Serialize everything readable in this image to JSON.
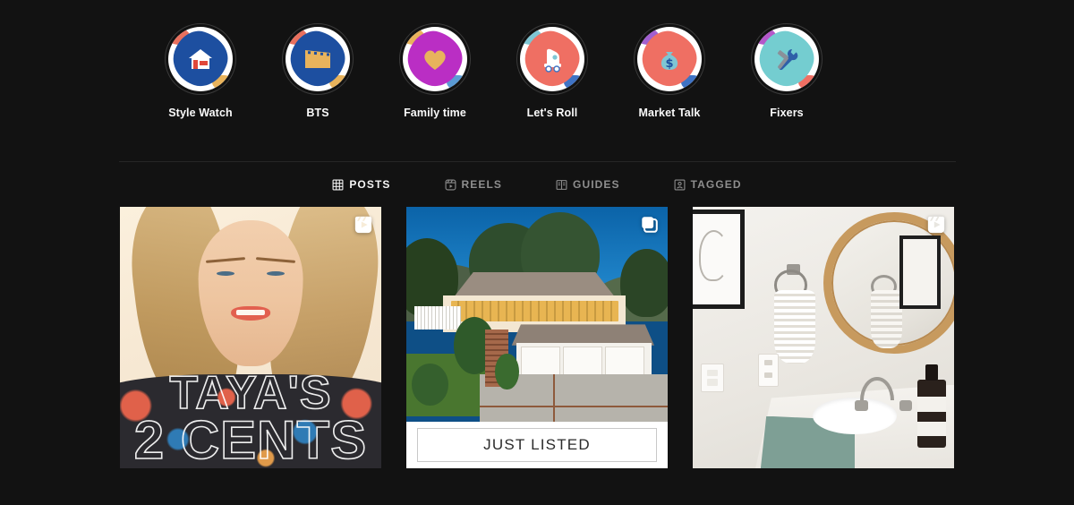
{
  "theme": {
    "background": "#121212",
    "text_primary": "#fafafa",
    "text_secondary": "#8e8e8e",
    "divider": "#262626"
  },
  "highlights": {
    "items": [
      {
        "label": "Style Watch",
        "icon": "house-icon",
        "cover_color": "#1d4fa0",
        "glyph_color": "#ffffff",
        "accent_a": "#e8705e",
        "accent_b": "#e8b35c"
      },
      {
        "label": "BTS",
        "icon": "clapperboard-icon",
        "cover_color": "#1d4fa0",
        "glyph_color": "#e8b35c",
        "accent_a": "#e8705e",
        "accent_b": "#e8b35c"
      },
      {
        "label": "Family time",
        "icon": "heart-icon",
        "cover_color": "#ba2ec4",
        "glyph_color": "#e8b35c",
        "accent_a": "#e8b35c",
        "accent_b": "#5b9bd5"
      },
      {
        "label": "Let's Roll",
        "icon": "roller-skate-icon",
        "cover_color": "#ef6f63",
        "glyph_color": "#ffffff",
        "accent_a": "#7fc6d4",
        "accent_b": "#3f73c4"
      },
      {
        "label": "Market Talk",
        "icon": "money-bag-icon",
        "cover_color": "#ef6f63",
        "glyph_color": "#7fc6d4",
        "accent_a": "#a15fd0",
        "accent_b": "#3f73c4"
      },
      {
        "label": "Fixers",
        "icon": "hammer-wrench-icon",
        "cover_color": "#74cdd0",
        "glyph_color": "#8a9099",
        "accent_a": "#b457c9",
        "accent_b": "#ef6f63"
      }
    ]
  },
  "tabs": {
    "items": [
      {
        "label": "POSTS",
        "icon": "grid-icon",
        "active": true
      },
      {
        "label": "REELS",
        "icon": "reels-icon",
        "active": false
      },
      {
        "label": "GUIDES",
        "icon": "book-icon",
        "active": false
      },
      {
        "label": "TAGGED",
        "icon": "tagged-person-icon",
        "active": false
      }
    ]
  },
  "posts": {
    "items": [
      {
        "id": "post-1",
        "badge": "reels-icon",
        "overlay_line1": "TAYA'S",
        "overlay_line2": "2 CENTS",
        "alt": "Blonde woman smiling in floral top with neon outline text"
      },
      {
        "id": "post-2",
        "badge": "carousel-icon",
        "banner_text": "JUST LISTED",
        "alt": "Twilight exterior photo of hillside home with three car garage"
      },
      {
        "id": "post-3",
        "badge": "reels-icon",
        "alt": "Bathroom vanity with round wood mirror, striped towel and soap dispenser"
      }
    ]
  }
}
